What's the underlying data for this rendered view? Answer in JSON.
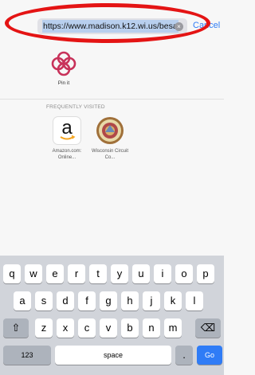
{
  "address_bar": {
    "url": "https://www.madison.k12.wi.us/besa",
    "clear_glyph": "×",
    "cancel_label": "Cancel"
  },
  "pinned": [
    {
      "label": "Pin it",
      "icon": "pin-it-knot-icon",
      "color": "#c8325a"
    }
  ],
  "frequently_visited": {
    "title": "FREQUENTLY VISITED",
    "items": [
      {
        "label": "Amazon.com: Online...",
        "icon": "amazon-icon"
      },
      {
        "label": "Wisconsin Circuit Co...",
        "icon": "wisconsin-seal-icon"
      }
    ]
  },
  "keyboard": {
    "row1": [
      "q",
      "w",
      "e",
      "r",
      "t",
      "y",
      "u",
      "i",
      "o",
      "p"
    ],
    "row2": [
      "a",
      "s",
      "d",
      "f",
      "g",
      "h",
      "j",
      "k",
      "l"
    ],
    "row3": [
      "z",
      "x",
      "c",
      "v",
      "b",
      "n",
      "m"
    ],
    "shift_glyph": "⇧",
    "delete_glyph": "⌫",
    "numbers_label": "123",
    "space_label": "space",
    "dot_label": ".",
    "go_label": "Go"
  },
  "colors": {
    "accent": "#2f7cf6",
    "annotation": "#e41414"
  }
}
